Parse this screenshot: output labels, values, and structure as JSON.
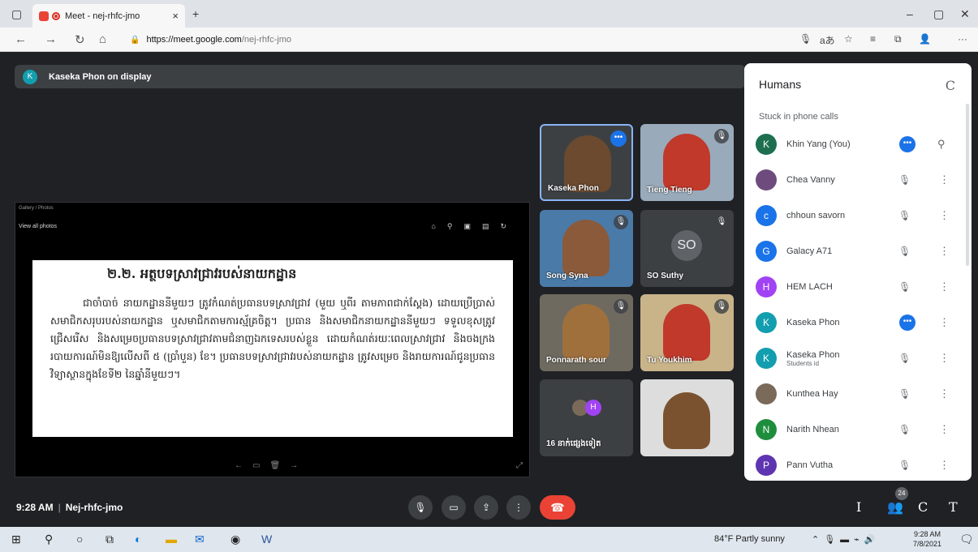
{
  "browser": {
    "tab_title": "Meet - nej-rhfc-jmo",
    "tab_close": "×",
    "new_tab": "+",
    "url_domain": "https://meet.google.com",
    "url_path": "/nej-rhfc-jmo"
  },
  "meet": {
    "presenter_initial": "K",
    "presenter_text": "Kaseka Phon on display",
    "photo_viewer_title": "Gallery / Photos",
    "photo_viewer_link": "View all photos",
    "slide": {
      "heading": "២.២. អត្ថបទស្រាវជ្រាវរបស់នាយកដ្ឋាន",
      "body": "ជាចាំបាច់ នាយកដ្ឋាននីមួយៗ ត្រូវកំណត់ប្រធានបទស្រាវជ្រាវ (មួយ ឬពីរ តាមភាពជាក់ស្តែង) ដោយប្រើប្រាស់សមាជិកសរុបរបស់នាយកដ្ឋាន ឬសមាជិកតាមការស្ម័គ្រចិត្ត។ ប្រធាន និងសមាជិកនាយកដ្ឋាននីមួយៗ ទទួលខុសត្រូវជ្រើសរើស និងសម្រេចប្រធានបទស្រាវជ្រាវតាមជំនាញឯកទេសរបស់ខ្លួន ដោយកំណត់រយៈពេលស្រាវជ្រាវ និងចងក្រងរបាយការណ៍មិនឱ្យលើសពី ៥ (ប្រាំបួន) ខែ។ ប្រធានបទស្រាវជ្រាវរបស់នាយកដ្ឋាន ត្រូវសម្រេច និងរាយការណ៍ជូនប្រធានវិទ្យាស្ថានក្នុងខែទី២ នៃឆ្នាំនីមួយៗ។"
    },
    "tiles": [
      {
        "name": "Kaseka Phon"
      },
      {
        "name": "Tieng Tieng"
      },
      {
        "name": "Song Syna"
      },
      {
        "name": "SO Suthy",
        "initials": "SO"
      },
      {
        "name": "Ponnarath sour"
      },
      {
        "name": "Tu Youkhim"
      },
      {
        "name": "16 នាក់ផ្សេងទៀត"
      },
      {
        "name": ""
      }
    ],
    "clock": "9:28 AM",
    "meeting_code": "Nej-rhfc-jmo",
    "people_count": "24",
    "bottom_right": [
      "I",
      "C",
      "T"
    ]
  },
  "panel": {
    "title": "Humans",
    "close": "C",
    "section": "Stuck in phone calls",
    "people": [
      {
        "initial": "K",
        "name": "Khin Yang (You)",
        "color": "#1e6f50"
      },
      {
        "initial": "",
        "name": "Chea Vanny",
        "color": "#6d4c7d"
      },
      {
        "initial": "c",
        "name": "chhoun savorn",
        "color": "#1a73e8"
      },
      {
        "initial": "G",
        "name": "Galacy A71",
        "color": "#1a73e8"
      },
      {
        "initial": "H",
        "name": "HEM LACH",
        "color": "#a142f4"
      },
      {
        "initial": "K",
        "name": "Kaseka Phon",
        "color": "#129eaf"
      },
      {
        "initial": "K",
        "name": "Kaseka Phon",
        "sub": "Students id",
        "color": "#129eaf"
      },
      {
        "initial": "",
        "name": "Kunthea Hay",
        "color": "#7a6a5a"
      },
      {
        "initial": "N",
        "name": "Narith Nhean",
        "color": "#1e8e3e"
      },
      {
        "initial": "P",
        "name": "Pann Vutha",
        "color": "#5e35b1"
      }
    ]
  },
  "taskbar": {
    "weather": "84°F Partly sunny",
    "time": "9:28 AM",
    "date": "7/8/2021"
  }
}
